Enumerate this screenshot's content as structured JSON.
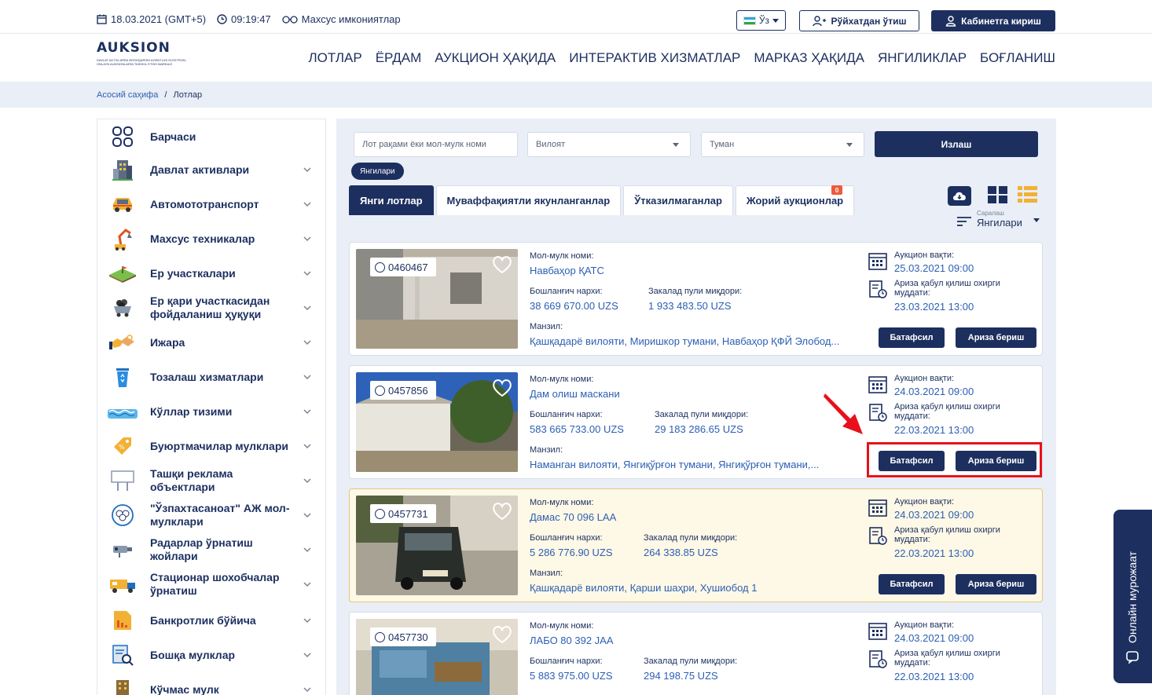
{
  "topbar": {
    "date": "18.03.2021 (GMT+5)",
    "time": "09:19:47",
    "accessibility": "Махсус имкониятлар",
    "language": "Ўз",
    "register": "Рўйхатдан ўтиш",
    "login": "Кабинетга кириш"
  },
  "header": {
    "logo_text": "AUKSION",
    "logo_tagline": "DAVLAT AKTIVLARINI BOSHQARISH AGENTLIGI ELEKTRON-ONLAYN AUKSIONLARNI TASHKIL ETISH MARKAZI",
    "nav": [
      "ЛОТЛАР",
      "ЁРДАМ",
      "АУКЦИОН ҲАҚИДА",
      "ИНТЕРАКТИВ ХИЗМАТЛАР",
      "МАРКАЗ ҲАҚИДА",
      "ЯНГИЛИКЛАР",
      "БОҒЛАНИШ"
    ]
  },
  "breadcrumb": {
    "home": "Асосий саҳифа",
    "separator": "/",
    "current": "Лотлар"
  },
  "sidebar": {
    "items": [
      {
        "label": "Барчаси",
        "icon": "grid-circles-icon"
      },
      {
        "label": "Давлат активлари",
        "icon": "building-icon"
      },
      {
        "label": "Автомототранспорт",
        "icon": "car-icon"
      },
      {
        "label": "Махсус техникалар",
        "icon": "excavator-icon"
      },
      {
        "label": "Ер участкалари",
        "icon": "land-plot-icon"
      },
      {
        "label": "Ер қари участкасидан фойдаланиш ҳуқуқи",
        "icon": "mining-cart-icon"
      },
      {
        "label": "Ижара",
        "icon": "handshake-key-icon"
      },
      {
        "label": "Тозалаш хизматлари",
        "icon": "trash-bin-icon"
      },
      {
        "label": "Кўллар тизими",
        "icon": "water-waves-icon"
      },
      {
        "label": "Буюртмачилар мулклари",
        "icon": "price-tag-icon"
      },
      {
        "label": "Ташқи реклама объектлари",
        "icon": "billboard-icon"
      },
      {
        "label": "\"Ўзпахтасаноат\" АЖ мол-мулклари",
        "icon": "cotton-icon"
      },
      {
        "label": "Радарлар ўрнатиш жойлари",
        "icon": "camera-radar-icon"
      },
      {
        "label": "Стационар шохобчалар ўрнатиш",
        "icon": "kiosk-truck-icon"
      },
      {
        "label": "Банкротлик бўйича",
        "icon": "chart-down-icon"
      },
      {
        "label": "Бошқа мулклар",
        "icon": "document-search-icon"
      },
      {
        "label": "Кўчмас мулк",
        "icon": "apartment-icon"
      }
    ]
  },
  "filters": {
    "search_placeholder": "Лот рақами ёки мол-мулк номи",
    "region": "Вилоят",
    "district": "Туман",
    "search_button": "Излаш",
    "chip": "Янгилари"
  },
  "tabs": [
    {
      "label": "Янги лотлар",
      "active": true
    },
    {
      "label": "Муваффақиятли якунланганлар",
      "active": false
    },
    {
      "label": "Ўтказилмаганлар",
      "active": false
    },
    {
      "label": "Жорий аукционлар",
      "active": false,
      "badge": "0"
    }
  ],
  "sort": {
    "label": "Саралаш",
    "value": "Янгилари"
  },
  "card_labels": {
    "name": "Мол-мулк номи:",
    "start_price": "Бошланғич нархи:",
    "deposit": "Закалад пули миқдори:",
    "address": "Манзил:",
    "auction_time": "Аукцион вақти:",
    "deadline": "Ариза қабул қилиш охирги муддати:",
    "more": "Батафсил",
    "apply": "Ариза бериш"
  },
  "lots": [
    {
      "number": "0460467",
      "name": "Навбаҳор ҚАТС",
      "start_price": "38 669 670.00 UZS",
      "deposit": "1 933 483.50 UZS",
      "address": "Қашқадарё вилояти, Миришкор тумани, Навбаҳор ҚФЙ Элобод...",
      "auction_time": "25.03.2021 09:00",
      "deadline": "23.03.2021 13:00"
    },
    {
      "number": "0457856",
      "name": "Дам олиш маскани",
      "start_price": "583 665 733.00 UZS",
      "deposit": "29 183 286.65 UZS",
      "address": "Наманган вилояти, Янгиқўрғон тумани, Янгиқўрғон тумани,...",
      "auction_time": "24.03.2021 09:00",
      "deadline": "22.03.2021 13:00"
    },
    {
      "number": "0457731",
      "name": "Дамас 70 096 LAA",
      "start_price": "5 286 776.90 UZS",
      "deposit": "264 338.85 UZS",
      "address": "Қашқадарё вилояти, Қарши шаҳри, Хушиобод 1",
      "auction_time": "24.03.2021 09:00",
      "deadline": "22.03.2021 13:00"
    },
    {
      "number": "0457730",
      "name": "ЛАБО 80 392 JAA",
      "start_price": "5 883 975.00 UZS",
      "deposit": "294 198.75 UZS",
      "address": "",
      "auction_time": "24.03.2021 09:00",
      "deadline": "22.03.2021 13:00"
    }
  ],
  "chat": {
    "label": "Онлайн мурожаат"
  },
  "colors": {
    "primary": "#1c2f5f",
    "link": "#2c5fb3",
    "highlight_bg": "#fef8e6",
    "annotation": "#e8101a"
  }
}
